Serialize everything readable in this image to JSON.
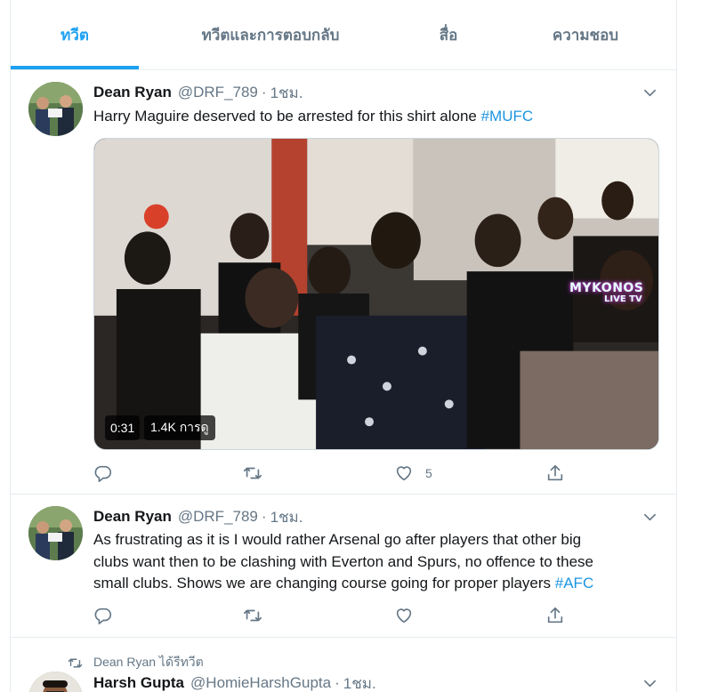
{
  "tabs": [
    {
      "label": "ทวีต",
      "active": true
    },
    {
      "label": "ทวีตและการตอบกลับ",
      "active": false
    },
    {
      "label": "สื่อ",
      "active": false
    },
    {
      "label": "ความชอบ",
      "active": false
    }
  ],
  "tweets": [
    {
      "name": "Dean Ryan",
      "handle": "@DRF_789",
      "time": "1ชม.",
      "text": "Harry Maguire deserved to be arrested for this shirt alone ",
      "hashtag": "#MUFC",
      "video": {
        "duration": "0:31",
        "views": "1.4K การดู",
        "watermark": "MYKONOS",
        "watermark_sub": "LIVE TV"
      },
      "likes": "5"
    },
    {
      "name": "Dean Ryan",
      "handle": "@DRF_789",
      "time": "1ชม.",
      "lines": [
        "As frustrating as it is I would rather Arsenal go after players that other big",
        "clubs want then to be clashing with Everton and Spurs, no offence to these",
        "small clubs. Shows we are changing course going for proper players "
      ],
      "hashtag": "#AFC"
    },
    {
      "retweet_context": "Dean Ryan ได้รีทวีต",
      "name": "Harsh Gupta",
      "handle": "@HomieHarshGupta",
      "time": "1ชม."
    }
  ],
  "colors": {
    "accent": "#1da1f2",
    "hashtag": "#1b95e0",
    "muted": "#657786",
    "border": "#e6ecf0"
  },
  "icons": [
    "reply-icon",
    "retweet-icon",
    "like-icon",
    "share-icon",
    "caret-down-icon"
  ]
}
